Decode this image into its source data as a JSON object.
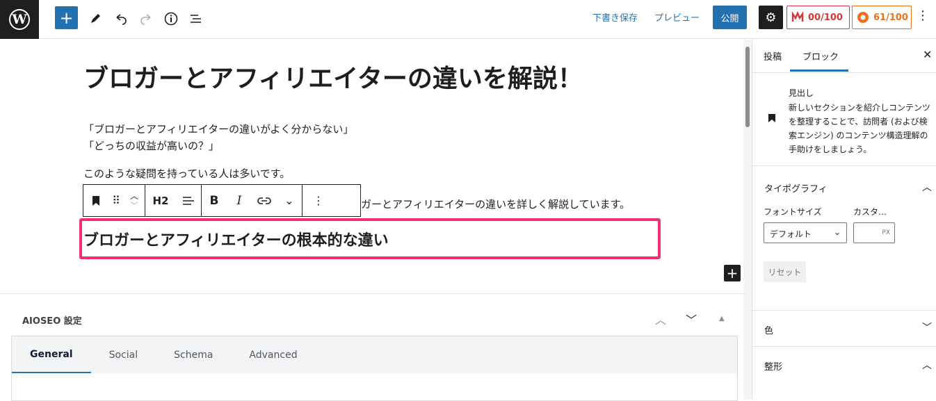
{
  "topbar": {
    "inserter_icon": "plus-icon",
    "draft_save": "下書き保存",
    "preview": "プレビュー",
    "publish": "公開",
    "seo_score": "00/100",
    "readability_score": "61/100",
    "colors": {
      "accent": "#2271b1",
      "seo_red": "#d63638",
      "score_orange": "#e8711c",
      "highlight": "#f0306f"
    }
  },
  "editor": {
    "title": "ブロガーとアフィリエイターの違いを解説！",
    "paragraphs": [
      "「ブロガーとアフィリエイターの違いがよく分からない」",
      "「どっちの収益が高いの？」",
      "このような疑問を持っている人は多いです。",
      "ガーとアフィリエイターの違いを詳しく解説しています。"
    ],
    "heading_level": "H2",
    "heading": "ブロガーとアフィリエイターの根本的な違い"
  },
  "aioseo": {
    "title": "AIOSEO 設定",
    "tabs": [
      "General",
      "Social",
      "Schema",
      "Advanced"
    ]
  },
  "sidebar": {
    "tabs": [
      "投稿",
      "ブロック"
    ],
    "block_title": "見出し",
    "block_desc": "新しいセクションを紹介しコンテンツを整理することで、訪問者 (および検索エンジン) のコンテンツ構造理解の手助けをしましょう。",
    "typography": "タイポグラフィ",
    "font_size_label": "フォントサイズ",
    "custom_label": "カスタ…",
    "font_size_value": "デフォルト",
    "unit": "PX",
    "reset": "リセット",
    "color_panel": "色",
    "layout_panel": "整形"
  }
}
